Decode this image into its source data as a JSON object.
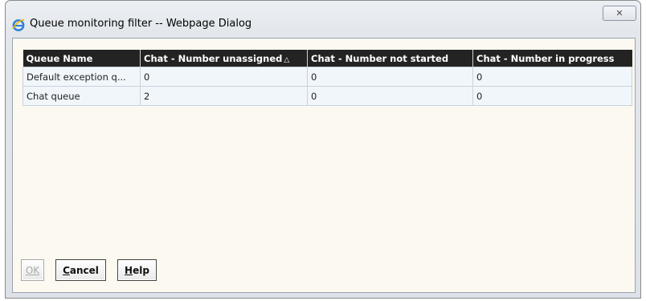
{
  "window": {
    "title": "Queue monitoring filter -- Webpage Dialog",
    "close_glyph": "✕"
  },
  "table": {
    "headers": [
      "Queue Name",
      "Chat - Number unassigned",
      "Chat - Number not started",
      "Chat - Number in progress"
    ],
    "sort_indicator": "△",
    "rows": [
      [
        "Default exception q...",
        "0",
        "0",
        "0"
      ],
      [
        "Chat queue",
        "2",
        "0",
        "0"
      ]
    ]
  },
  "buttons": {
    "ok": "OK",
    "cancel": "Cancel",
    "help": "Help"
  },
  "colors": {
    "header_bg": "#232323",
    "cell_bg": "#f1f6fb",
    "content_bg": "#fcf9f0"
  }
}
